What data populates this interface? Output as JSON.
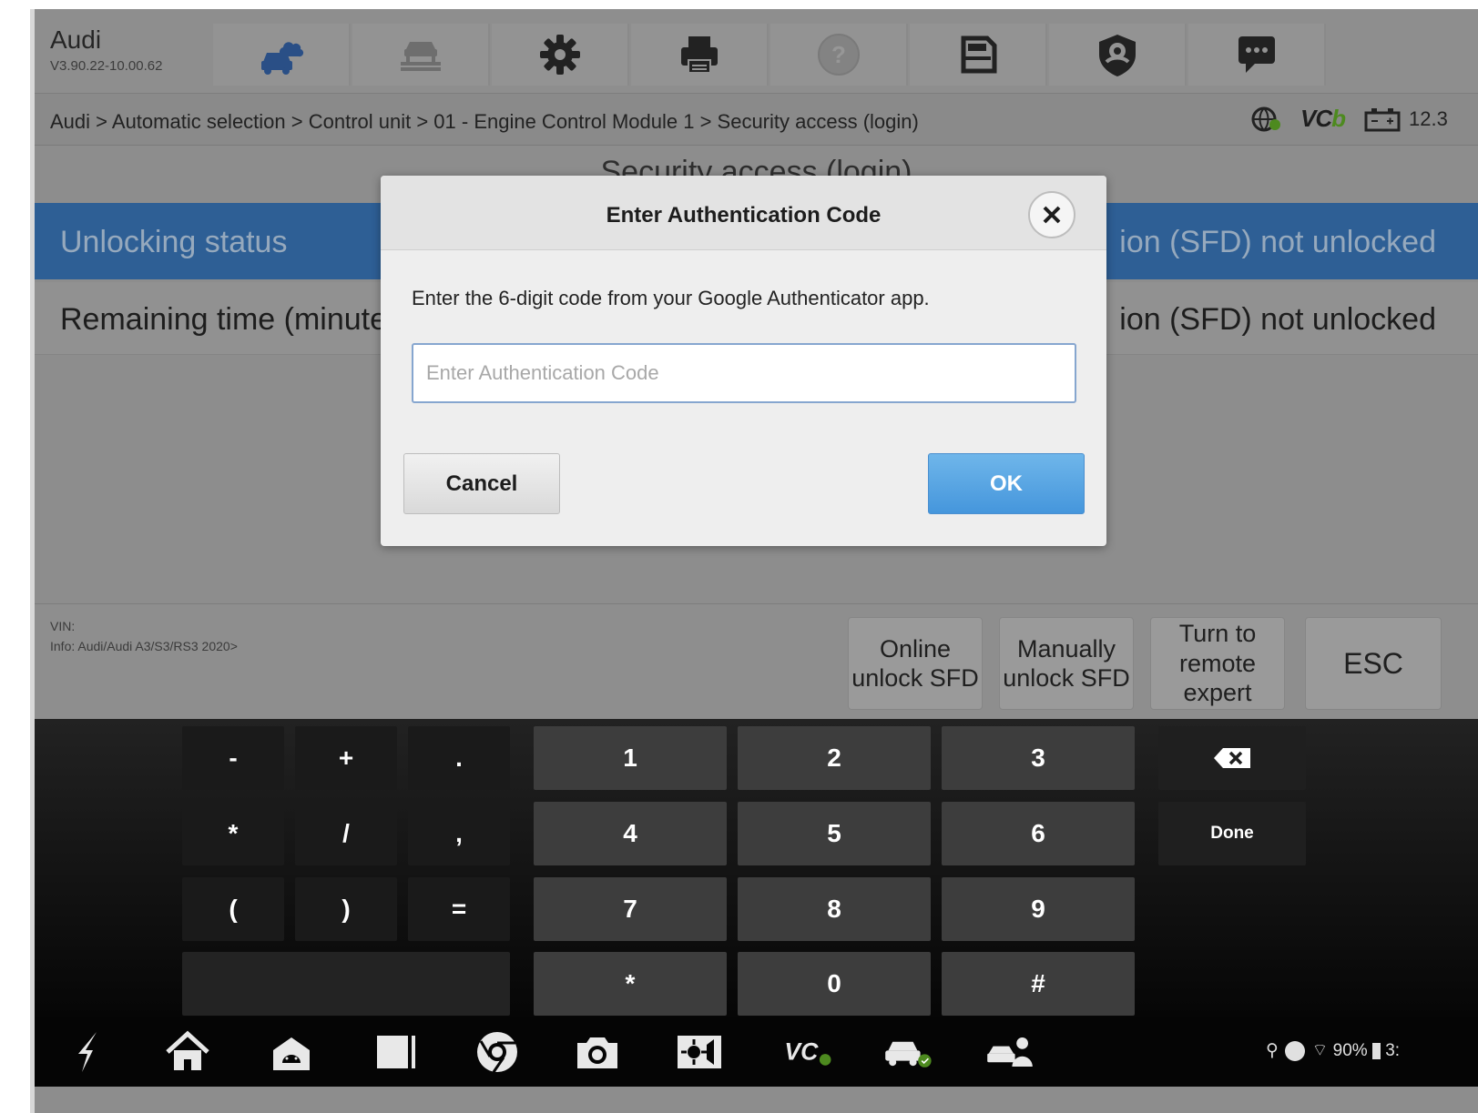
{
  "app": {
    "name": "Audi",
    "version": "V3.90.22-10.00.62"
  },
  "toolbar": {
    "icons": [
      "car-cloud-icon",
      "car-lift-icon",
      "gear-icon",
      "printer-icon",
      "help-icon",
      "save-icon",
      "shield-icon",
      "chat-icon"
    ]
  },
  "breadcrumb": "Audi > Automatic selection > Control unit > 01 - Engine Control Module 1 > Security access (login)",
  "status": {
    "vci": "VC",
    "vci_suffix": "b",
    "battery": "12.3"
  },
  "page": {
    "title": "Security access (login)",
    "rows": [
      {
        "label": "Unlocking status",
        "value": "ion (SFD) not unlocked"
      },
      {
        "label": "Remaining time (minutes",
        "value": "ion (SFD) not unlocked"
      }
    ]
  },
  "vehicle": {
    "vin": "VIN: ",
    "info": "Info: Audi/Audi A3/S3/RS3 2020>"
  },
  "actions": {
    "online_unlock": "Online\nunlock SFD",
    "manual_unlock": "Manually\nunlock SFD",
    "remote_expert": "Turn to\nremote\nexpert",
    "esc": "ESC"
  },
  "dialog": {
    "title": "Enter Authentication Code",
    "message": "Enter the 6-digit code from your Google Authenticator app.",
    "input_placeholder": "Enter Authentication Code",
    "input_value": "",
    "cancel_label": "Cancel",
    "ok_label": "OK"
  },
  "keyboard": {
    "symbols": [
      "-",
      "+",
      ".",
      "*",
      "/",
      ",",
      "(",
      ")",
      "="
    ],
    "digits": [
      "1",
      "2",
      "3",
      "4",
      "5",
      "6",
      "7",
      "8",
      "9",
      "*",
      "0",
      "#"
    ],
    "done_label": "Done"
  },
  "navbar": {
    "icons": [
      "back-icon",
      "home-icon",
      "android-icon",
      "recents-icon",
      "chrome-icon",
      "camera-icon",
      "brightness-icon",
      "vci-icon",
      "car-check-icon",
      "remote-support-icon"
    ],
    "vci_label": "VC",
    "status_text": "90%",
    "clock": "3:"
  },
  "colors": {
    "accent": "#2e5f95",
    "ok_button": "#4596dc",
    "vci_green": "#4d8a1f"
  }
}
